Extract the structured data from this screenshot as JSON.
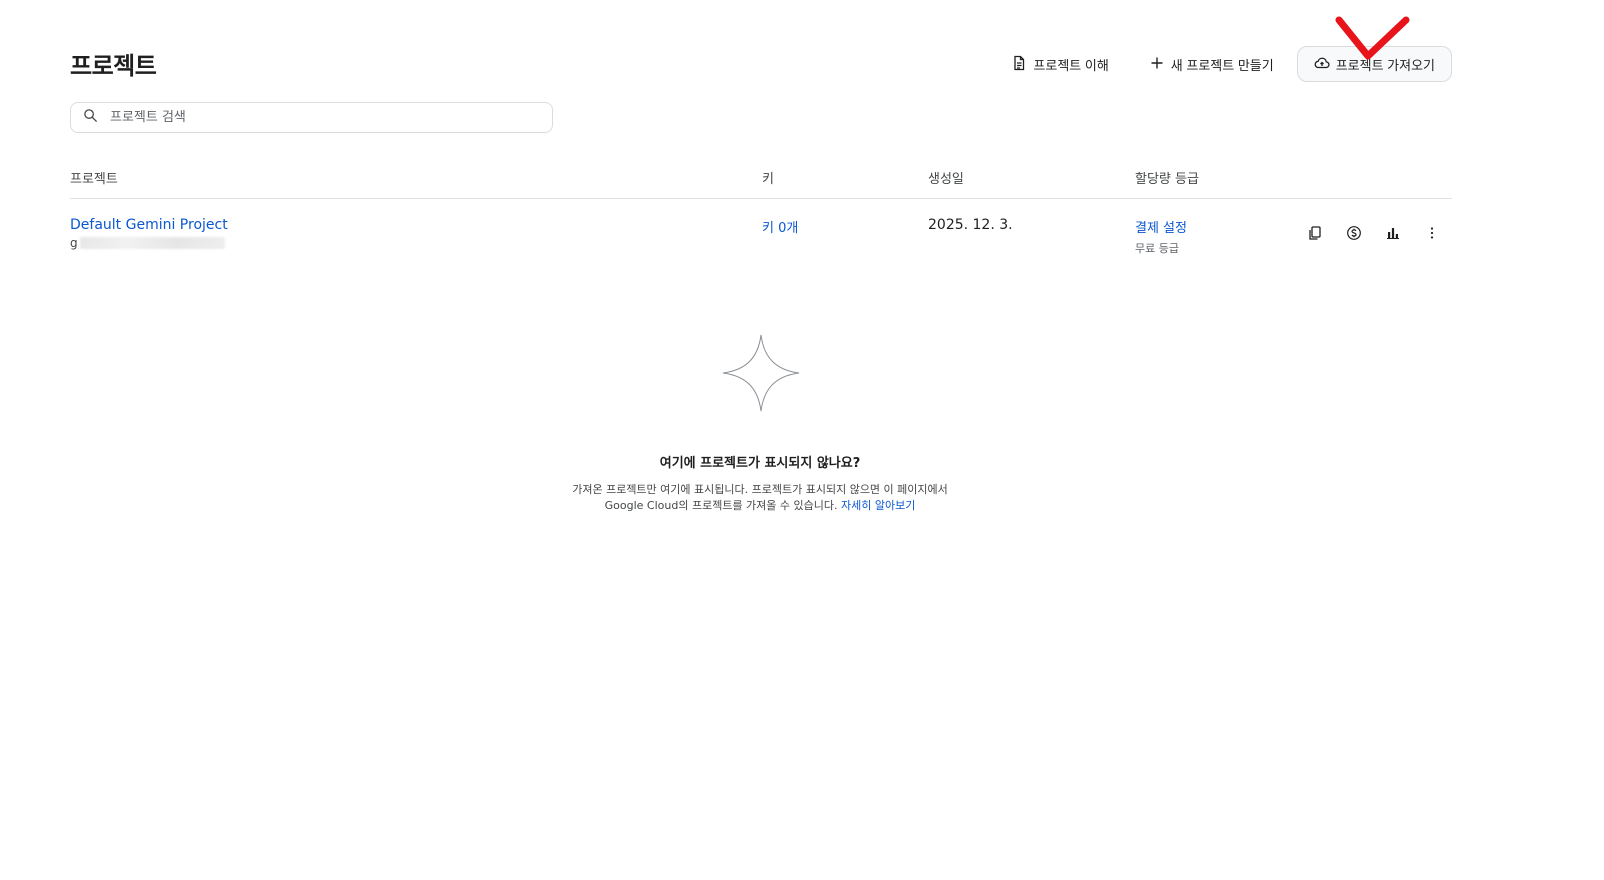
{
  "page": {
    "title": "프로젝트"
  },
  "header": {
    "understand_label": "프로젝트 이해",
    "create_label": "새 프로젝트 만들기",
    "import_label": "프로젝트 가져오기"
  },
  "search": {
    "placeholder": "프로젝트 검색"
  },
  "table": {
    "columns": {
      "project": "프로젝트",
      "keys": "키",
      "created": "생성일",
      "tier": "할당량 등급"
    },
    "rows": [
      {
        "name": "Default Gemini Project",
        "id_prefix": "g",
        "keys": "키 0개",
        "created": "2025. 12. 3.",
        "tier_link": "결제 설정",
        "tier_label": "무료 등급"
      }
    ]
  },
  "empty_state": {
    "title": "여기에 프로젝트가 표시되지 않나요?",
    "line1": "가져온 프로젝트만 여기에 표시됩니다. 프로젝트가 표시되지 않으면 이 페이지에서",
    "line2": "Google Cloud의 프로젝트를 가져올 수 있습니다.",
    "learn_more": "자세히 알아보기"
  },
  "colors": {
    "link": "#0b57d0",
    "annotation": "#e8141b"
  },
  "icons": [
    "doc-icon",
    "plus-icon",
    "cloud-upload-icon",
    "search-icon",
    "copy-icon",
    "billing-icon",
    "bar-chart-icon",
    "more-vert-icon",
    "sparkle-icon",
    "checkmark-annotation"
  ]
}
